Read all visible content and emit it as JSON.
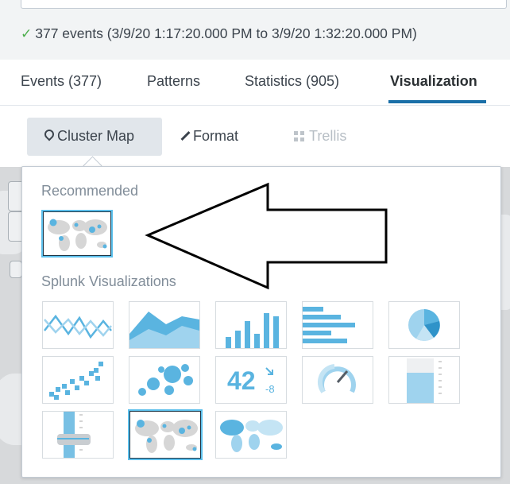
{
  "search": {
    "status_text": "377 events (3/9/20 1:17:20.000 PM to 3/9/20 1:32:20.000 PM)"
  },
  "tabs": [
    {
      "label": "Events (377)"
    },
    {
      "label": "Patterns"
    },
    {
      "label": "Statistics (905)"
    },
    {
      "label": "Visualization",
      "active": true
    }
  ],
  "toolbar": {
    "viz_label": "Cluster Map",
    "format_label": "Format",
    "trellis_label": "Trellis"
  },
  "popup": {
    "recommended_title": "Recommended",
    "recommended": [
      {
        "icon": "cluster-map-icon",
        "selected": true
      }
    ],
    "splunk_title": "Splunk Visualizations",
    "visualizations": [
      {
        "icon": "line-chart-icon"
      },
      {
        "icon": "area-chart-icon"
      },
      {
        "icon": "column-chart-icon"
      },
      {
        "icon": "bar-chart-icon"
      },
      {
        "icon": "pie-chart-icon"
      },
      {
        "icon": "scatter-chart-icon"
      },
      {
        "icon": "bubble-chart-icon"
      },
      {
        "icon": "single-value-icon",
        "value": "42",
        "delta": "-8"
      },
      {
        "icon": "radial-gauge-icon"
      },
      {
        "icon": "filler-gauge-icon"
      },
      {
        "icon": "marker-gauge-icon"
      },
      {
        "icon": "cluster-map-icon",
        "selected": true
      },
      {
        "icon": "choropleth-map-icon"
      }
    ]
  },
  "colors": {
    "accent": "#1a6fa8",
    "viz_blue": "#5ab4e0",
    "selected_border": "#5cc0ec",
    "success": "#4cae4c"
  }
}
